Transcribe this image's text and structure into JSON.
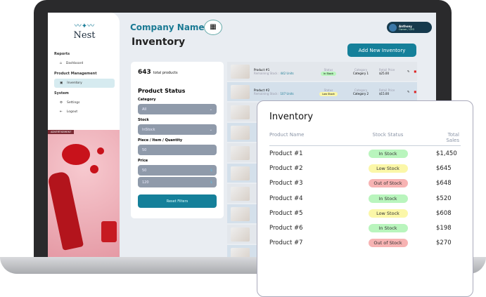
{
  "sidebar": {
    "logo": "Nest",
    "sections": [
      {
        "label": "Reports",
        "items": [
          {
            "label": "Dashboard",
            "icon": "home-icon"
          }
        ]
      },
      {
        "label": "Product Management",
        "items": [
          {
            "label": "Inventory",
            "icon": "box-icon",
            "active": true
          }
        ]
      },
      {
        "label": "System",
        "items": [
          {
            "label": "Settings",
            "icon": "gear-icon"
          },
          {
            "label": "Logout",
            "icon": "logout-icon"
          }
        ]
      }
    ],
    "ad_label": "ADVERTISEMENT"
  },
  "header": {
    "company": "Company Name",
    "title": "Inventory",
    "user": {
      "name": "Anthony",
      "role": "Owner / CEO"
    },
    "add_button": "Add New Inventory"
  },
  "filters": {
    "total": "643",
    "total_label": "total products",
    "heading": "Product Status",
    "category_label": "Category",
    "category": "All",
    "stock_label": "Stock",
    "stock": "InStock",
    "qty_label": "Piece / Item / Quantity",
    "qty": "50",
    "price_label": "Price",
    "price_min": "50",
    "price_max": "120",
    "currency": "$",
    "reset": "Reset Filters"
  },
  "list": {
    "labels": {
      "remaining": "Remaining Stock :",
      "status": "Status",
      "category": "Category",
      "price": "Retail Price"
    },
    "rows": [
      {
        "name": "Product #1",
        "stock": "442 Units",
        "status": "In Stock",
        "category": "Category 1",
        "price": "$25.00"
      },
      {
        "name": "Product #2",
        "stock": "107 Units",
        "status": "Low Stock",
        "category": "Category 2",
        "price": "$15.00"
      }
    ]
  },
  "card": {
    "title": "Inventory",
    "columns": [
      "Product Name",
      "Stock Status",
      "Total Sales"
    ],
    "rows": [
      {
        "name": "Product #1",
        "status": "In Stock",
        "sales": "$1,450"
      },
      {
        "name": "Product #2",
        "status": "Low Stock",
        "sales": "$645"
      },
      {
        "name": "Product #3",
        "status": "Out of Stock",
        "sales": "$648"
      },
      {
        "name": "Product #4",
        "status": "In Stock",
        "sales": "$520"
      },
      {
        "name": "Product #5",
        "status": "Low Stock",
        "sales": "$608"
      },
      {
        "name": "Product #6",
        "status": "In Stock",
        "sales": "$198"
      },
      {
        "name": "Product #7",
        "status": "Out of Stock",
        "sales": "$270"
      }
    ]
  },
  "colors": {
    "accent": "#15809a",
    "in_stock": "#b9f5bd",
    "low_stock": "#fbf7a8",
    "out_of_stock": "#f7b3b3"
  }
}
